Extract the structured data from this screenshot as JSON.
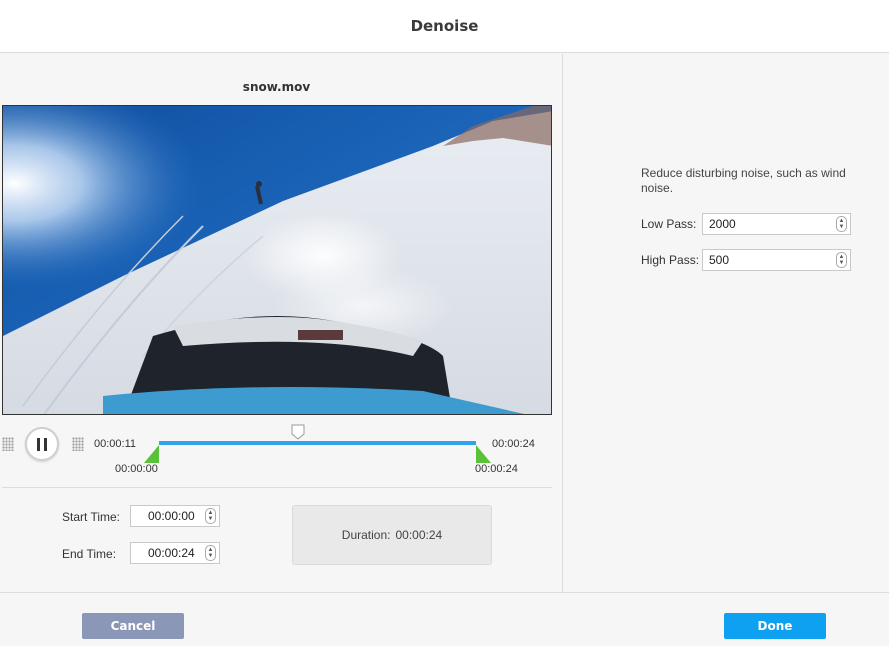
{
  "dialog": {
    "title": "Denoise"
  },
  "preview": {
    "file_name": "snow.mov",
    "current_time": "00:00:11",
    "total_time": "00:00:24",
    "trim_start_label": "00:00:00",
    "trim_end_label": "00:00:24",
    "playhead_progress": 0.44
  },
  "trim": {
    "start_label": "Start Time:",
    "start_value": "00:00:00",
    "end_label": "End Time:",
    "end_value": "00:00:24",
    "duration_label": "Duration:",
    "duration_value": "00:00:24"
  },
  "settings": {
    "description": "Reduce disturbing noise, such as wind noise.",
    "low_pass_label": "Low Pass:",
    "low_pass_value": "2000",
    "high_pass_label": "High Pass:",
    "high_pass_value": "500"
  },
  "footer": {
    "cancel_label": "Cancel",
    "done_label": "Done"
  },
  "colors": {
    "accent": "#0ea1f1",
    "cancel": "#8a97b6",
    "track": "#2fa3ec",
    "trim_marker": "#59c23a"
  },
  "icons": {
    "pause": "pause-icon",
    "grip": "grip-icon",
    "spinner": "spinner-arrows-icon"
  }
}
